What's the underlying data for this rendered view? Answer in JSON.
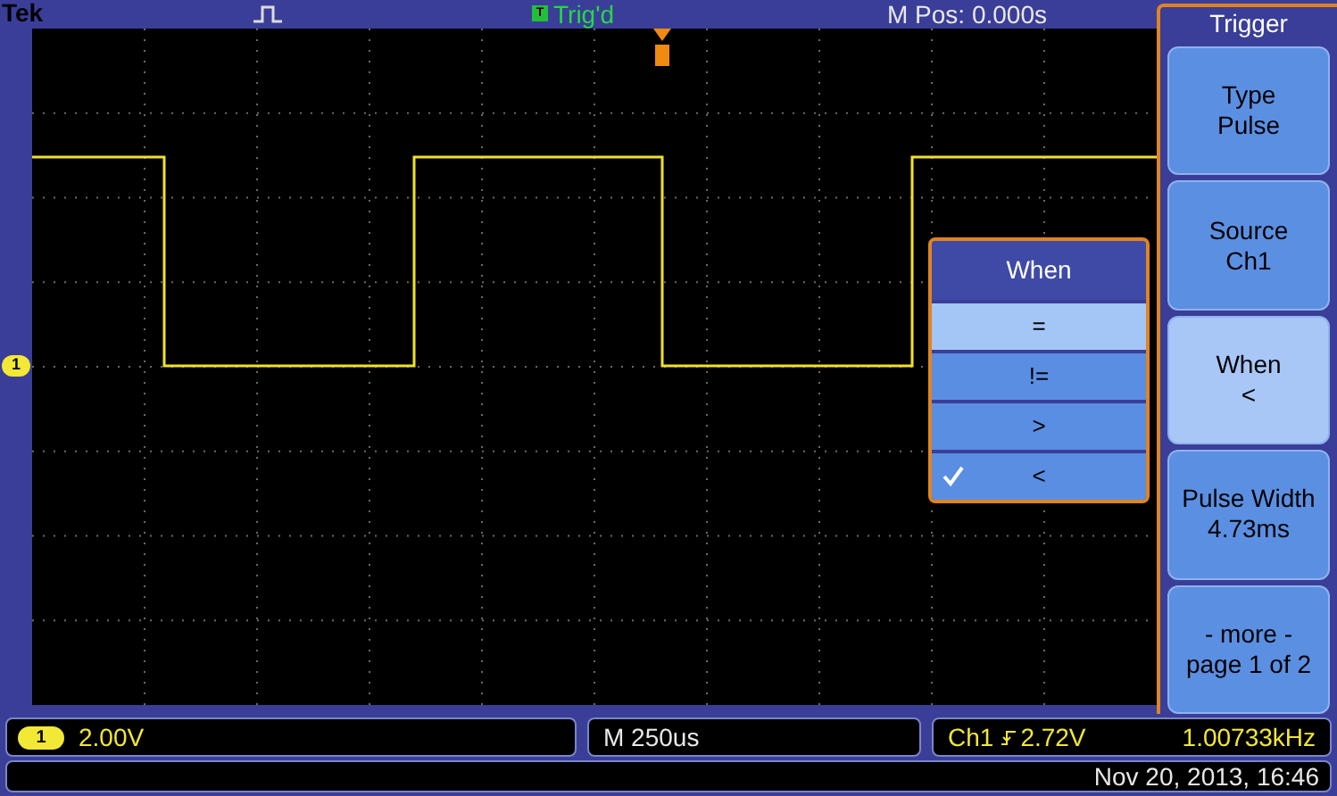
{
  "header": {
    "brand": "Tek",
    "trigger_status_badge": "T",
    "trigger_status": "Trig'd",
    "horizontal_position": "M Pos: 0.000s"
  },
  "channel_marker": "1",
  "popup_menu": {
    "title": "When",
    "items": [
      {
        "label": "=",
        "selected": true,
        "checked": false
      },
      {
        "label": "!=",
        "selected": false,
        "checked": false
      },
      {
        "label": ">",
        "selected": false,
        "checked": false
      },
      {
        "label": "<",
        "selected": false,
        "checked": true
      }
    ]
  },
  "side_menu": {
    "title": "Trigger",
    "buttons": [
      {
        "line1": "Type",
        "line2": "Pulse",
        "selected": false
      },
      {
        "line1": "Source",
        "line2": "Ch1",
        "selected": false
      },
      {
        "line1": "When",
        "line2": "<",
        "selected": true
      },
      {
        "line1": "Pulse Width",
        "line2": "4.73ms",
        "selected": false
      },
      {
        "line1": "- more -",
        "line2": "page 1 of 2",
        "selected": false
      }
    ]
  },
  "status_bar": {
    "channel_badge": "1",
    "vertical_scale": "2.00V",
    "timebase": "M 250us",
    "trigger_source": "Ch1",
    "trigger_level": "2.72V",
    "frequency": "1.00733kHz",
    "datetime": "Nov 20, 2013, 16:46"
  }
}
